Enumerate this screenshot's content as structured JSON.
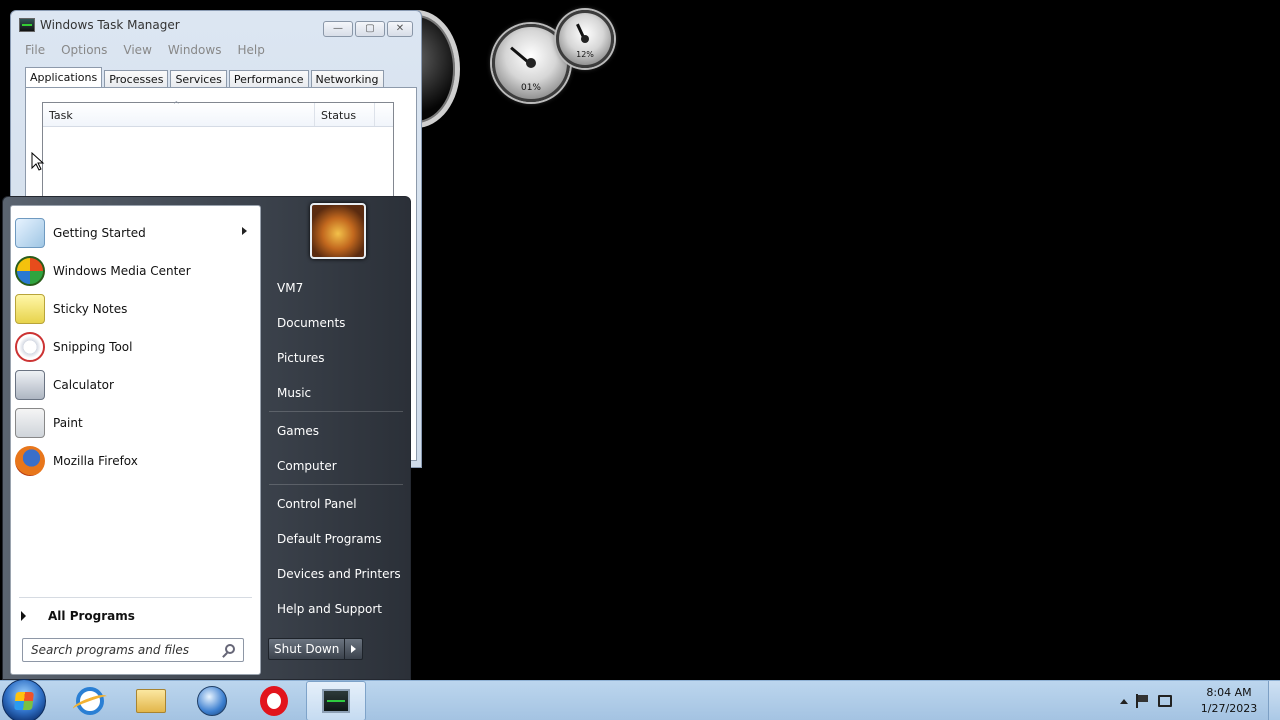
{
  "gadgets": {
    "cpu_value": "01%",
    "memory_value": "12%"
  },
  "taskmgr": {
    "title": "Windows Task Manager",
    "menu": [
      "File",
      "Options",
      "View",
      "Windows",
      "Help"
    ],
    "tabs": [
      "Applications",
      "Processes",
      "Services",
      "Performance",
      "Networking"
    ],
    "active_tab": "Applications",
    "columns": [
      "Task",
      "Status"
    ],
    "controls": {
      "minimize": "—",
      "maximize": "▢",
      "close": "✕"
    }
  },
  "start_menu": {
    "programs": [
      {
        "label": "Getting Started",
        "icon": "getting-started-icon",
        "has_submenu": true
      },
      {
        "label": "Windows Media Center",
        "icon": "media-center-icon"
      },
      {
        "label": "Sticky Notes",
        "icon": "sticky-notes-icon"
      },
      {
        "label": "Snipping Tool",
        "icon": "snipping-tool-icon"
      },
      {
        "label": "Calculator",
        "icon": "calculator-icon"
      },
      {
        "label": "Paint",
        "icon": "paint-icon"
      },
      {
        "label": "Mozilla Firefox",
        "icon": "firefox-icon"
      }
    ],
    "all_programs": "All Programs",
    "search_placeholder": "Search programs and files",
    "places": [
      "VM7",
      "Documents",
      "Pictures",
      "Music",
      "Games",
      "Computer",
      "Control Panel",
      "Default Programs",
      "Devices and Printers",
      "Help and Support"
    ],
    "shutdown_label": "Shut Down"
  },
  "taskbar": {
    "items": [
      "start-orb",
      "internet-explorer-icon",
      "windows-explorer-icon",
      "globe-browser-icon",
      "opera-icon",
      "task-manager-icon"
    ],
    "clock_time": "8:04 AM",
    "clock_date": "1/27/2023"
  }
}
